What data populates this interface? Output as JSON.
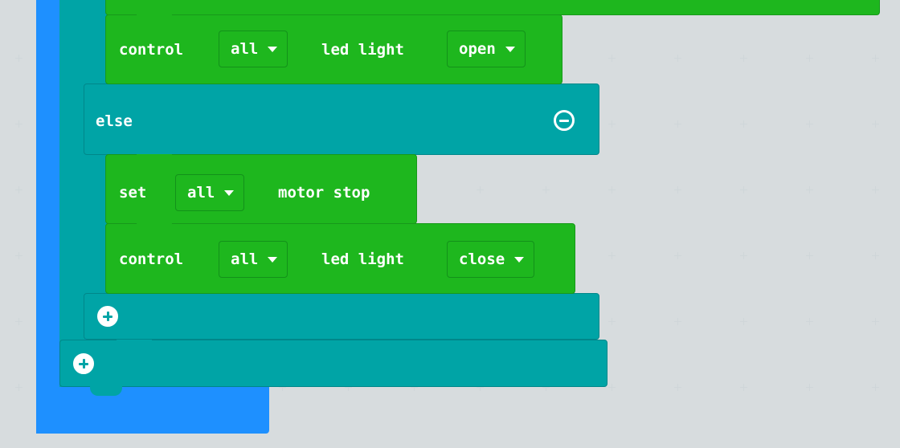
{
  "colors": {
    "workspace_bg": "#ecf0f1",
    "loop_block": "#1e90ff",
    "logic_block": "#00a4a6",
    "action_block": "#1eb71e"
  },
  "blocks": {
    "led_open": {
      "keyword": "control",
      "target": "all",
      "label": "led light",
      "state": "open"
    },
    "else_label": "else",
    "motor_stop": {
      "keyword": "set",
      "target": "all",
      "label": "motor stop"
    },
    "led_close": {
      "keyword": "control",
      "target": "all",
      "label": "led light",
      "state": "close"
    }
  },
  "icons": {
    "remove_else": "minus-circle-icon",
    "add_branch_inner": "plus-circle-icon",
    "add_branch_outer": "plus-circle-icon"
  }
}
